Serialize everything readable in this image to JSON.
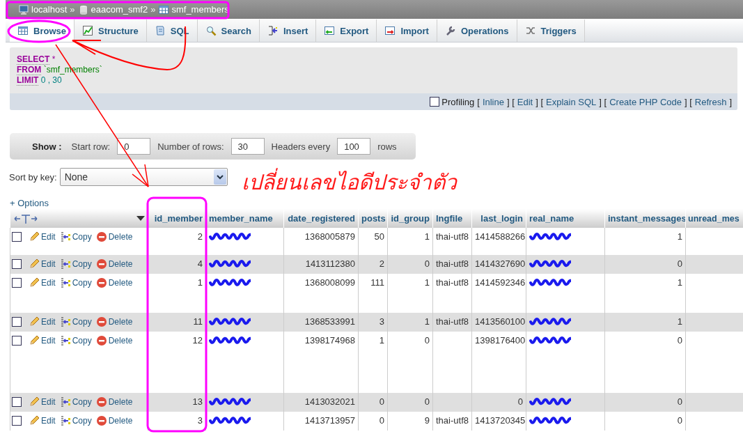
{
  "breadcrumb": [
    {
      "label": "localhost",
      "kind": "server"
    },
    {
      "label": "eaacom_smf2",
      "kind": "database"
    },
    {
      "label": "smf_members",
      "kind": "table"
    }
  ],
  "breadcrumb_separator": "»",
  "tabs": [
    {
      "label": "Browse",
      "kind": "browse",
      "selected": true
    },
    {
      "label": "Structure",
      "kind": "structure",
      "selected": false
    },
    {
      "label": "SQL",
      "kind": "sql",
      "selected": false
    },
    {
      "label": "Search",
      "kind": "search",
      "selected": false
    },
    {
      "label": "Insert",
      "kind": "insert",
      "selected": false
    },
    {
      "label": "Export",
      "kind": "export",
      "selected": false
    },
    {
      "label": "Import",
      "kind": "import",
      "selected": false
    },
    {
      "label": "Operations",
      "kind": "operations",
      "selected": false
    },
    {
      "label": "Triggers",
      "kind": "triggers",
      "selected": false
    }
  ],
  "query": [
    [
      {
        "text": "SELECT",
        "kind": "keyword"
      },
      {
        "text": "*",
        "kind": "operator"
      }
    ],
    [
      {
        "text": "FROM",
        "kind": "keyword"
      },
      {
        "text": "`smf_members`",
        "kind": "identifier"
      }
    ],
    [
      {
        "text": "LIMIT",
        "kind": "keyword"
      },
      {
        "text": "0 , 30",
        "kind": "number"
      }
    ]
  ],
  "query_actions": [
    {
      "kind": "checkbox",
      "text": "Profiling",
      "checked": false
    },
    {
      "kind": "text",
      "text": "["
    },
    {
      "kind": "link",
      "text": "Inline"
    },
    {
      "kind": "text",
      "text": "] ["
    },
    {
      "kind": "link",
      "text": "Edit"
    },
    {
      "kind": "text",
      "text": "] ["
    },
    {
      "kind": "link",
      "text": "Explain SQL"
    },
    {
      "kind": "text",
      "text": "] ["
    },
    {
      "kind": "link",
      "text": "Create PHP Code"
    },
    {
      "kind": "text",
      "text": "] ["
    },
    {
      "kind": "link",
      "text": "Refresh"
    },
    {
      "kind": "text",
      "text": "]"
    }
  ],
  "show_bar": {
    "title": "Show :",
    "fields": [
      {
        "label": "Start row:",
        "value": "0"
      },
      {
        "label": "Number of rows:",
        "value": "30"
      },
      {
        "label": "Headers every",
        "value": "100"
      }
    ],
    "suffix": "rows"
  },
  "sort": {
    "label": "Sort by key:",
    "value": "None"
  },
  "annotation_text": "เปลี่ยนเลขไอดีประจำตัว",
  "options_link": "+ Options",
  "table": {
    "columns": [
      {
        "label": "id_member"
      },
      {
        "label": "member_name"
      },
      {
        "label": "date_registered"
      },
      {
        "label": "posts"
      },
      {
        "label": "id_group"
      },
      {
        "label": "lngfile"
      },
      {
        "label": "last_login"
      },
      {
        "label": "real_name"
      },
      {
        "label": "instant_messages"
      },
      {
        "label": "unread_mes"
      }
    ],
    "rows": [
      {
        "checked": false,
        "actions": [
          "Edit",
          "Copy",
          "Delete"
        ],
        "cells": [
          "2",
          {
            "kind": "scribble"
          },
          "1368005879",
          "50",
          "1",
          "thai-utf8",
          "1414588266",
          {
            "kind": "scribble"
          },
          "1",
          null
        ]
      },
      {
        "checked": false,
        "actions": [
          "Edit",
          "Copy",
          "Delete"
        ],
        "cells": [
          "4",
          {
            "kind": "scribble"
          },
          "1413112380",
          "2",
          "0",
          "thai-utf8",
          "1414327690",
          {
            "kind": "scribble"
          },
          "0",
          null
        ]
      },
      {
        "checked": false,
        "actions": [
          "Edit",
          "Copy",
          "Delete"
        ],
        "cells": [
          "1",
          {
            "kind": "scribble"
          },
          "1368008099",
          "111",
          "1",
          "thai-utf8",
          "1414592346",
          {
            "kind": "scribble"
          },
          "1",
          null
        ]
      },
      {
        "checked": false,
        "actions": [
          "Edit",
          "Copy",
          "Delete"
        ],
        "cells": [
          "11",
          {
            "kind": "scribble"
          },
          "1368533991",
          "3",
          "1",
          "thai-utf8",
          "1413560100",
          {
            "kind": "scribble"
          },
          "1",
          null
        ]
      },
      {
        "checked": false,
        "actions": [
          "Edit",
          "Copy",
          "Delete"
        ],
        "cells": [
          "12",
          {
            "kind": "scribble"
          },
          "1398174968",
          "1",
          "0",
          null,
          "1398176400",
          {
            "kind": "scribble"
          },
          "0",
          null
        ]
      },
      {
        "checked": false,
        "actions": [
          "Edit",
          "Copy",
          "Delete"
        ],
        "cells": [
          "13",
          {
            "kind": "scribble"
          },
          "1413032021",
          "0",
          "0",
          null,
          "0",
          {
            "kind": "scribble"
          },
          "0",
          null
        ]
      },
      {
        "checked": false,
        "actions": [
          "Edit",
          "Copy",
          "Delete"
        ],
        "cells": [
          "3",
          {
            "kind": "scribble"
          },
          "1413713957",
          "0",
          "9",
          "thai-utf8",
          "1413720345",
          {
            "kind": "scribble"
          },
          "0",
          null
        ]
      }
    ]
  }
}
